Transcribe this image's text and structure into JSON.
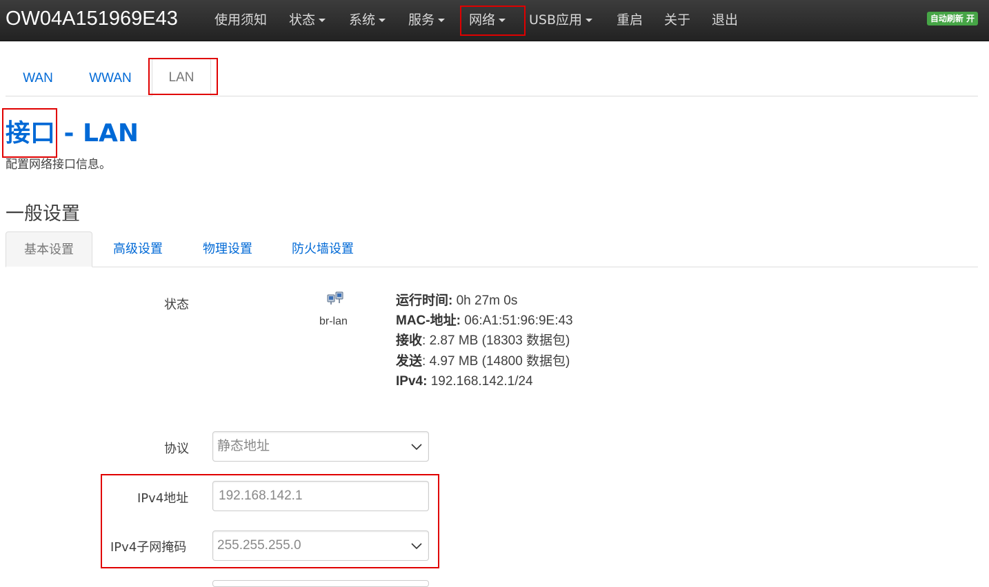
{
  "header": {
    "brand": "OW04A151969E43",
    "nav": [
      {
        "label": "使用须知",
        "dropdown": false
      },
      {
        "label": "状态",
        "dropdown": true
      },
      {
        "label": "系统",
        "dropdown": true
      },
      {
        "label": "服务",
        "dropdown": true
      },
      {
        "label": "网络",
        "dropdown": true
      },
      {
        "label": "USB应用",
        "dropdown": true
      },
      {
        "label": "重启",
        "dropdown": false
      },
      {
        "label": "关于",
        "dropdown": false
      },
      {
        "label": "退出",
        "dropdown": false
      }
    ],
    "autorefresh": "自动刷新 开"
  },
  "interface_tabs": [
    "WAN",
    "WWAN",
    "LAN"
  ],
  "active_interface_tab": "LAN",
  "page": {
    "title_prefix": "接口",
    "title_suffix": " - LAN",
    "description": "配置网络接口信息。",
    "section_title": "一般设置"
  },
  "settings_tabs": [
    "基本设置",
    "高级设置",
    "物理设置",
    "防火墙设置"
  ],
  "active_settings_tab": "基本设置",
  "status": {
    "label": "状态",
    "device": "br-lan",
    "lines": [
      {
        "key": "运行时间:",
        "value": " 0h 27m 0s"
      },
      {
        "key": "MAC-地址:",
        "value": " 06:A1:51:96:9E:43"
      },
      {
        "key": "接收",
        "value": ": 2.87 MB (18303 数据包)"
      },
      {
        "key": "发送",
        "value": ": 4.97 MB (14800 数据包)"
      },
      {
        "key": "IPv4:",
        "value": " 192.168.142.1/24"
      }
    ]
  },
  "form": {
    "protocol_label": "协议",
    "protocol_value": "静态地址",
    "ipv4_addr_label": "IPv4地址",
    "ipv4_addr_value": "192.168.142.1",
    "ipv4_mask_label": "IPv4子网掩码",
    "ipv4_mask_value": "255.255.255.0"
  },
  "colors": {
    "link": "#0069d6",
    "highlight": "#e00000",
    "navbar": "#222222",
    "badge": "#46a546"
  }
}
